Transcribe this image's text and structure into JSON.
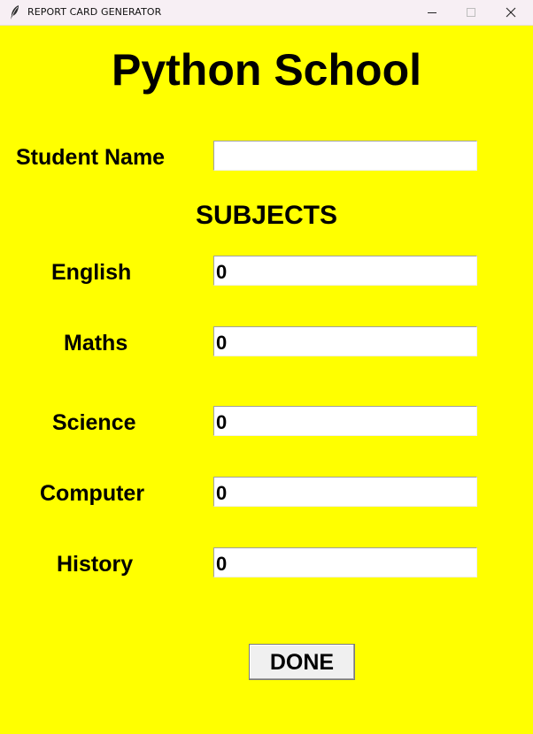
{
  "window": {
    "title": "REPORT CARD GENERATOR",
    "icon": "feather-icon",
    "controls": [
      "minimize-icon",
      "maximize-icon",
      "close-icon"
    ]
  },
  "heading": "Python School",
  "student": {
    "label": "Student Name",
    "value": ""
  },
  "subjects_heading": "SUBJECTS",
  "subjects": [
    {
      "label": "English",
      "value": "0"
    },
    {
      "label": "Maths",
      "value": "0"
    },
    {
      "label": "Science",
      "value": "0"
    },
    {
      "label": "Computer",
      "value": "0"
    },
    {
      "label": "History",
      "value": "0"
    }
  ],
  "done_label": "DONE",
  "colors": {
    "background": "#ffff00",
    "titlebar": "#f7eff4",
    "button": "#f0f0f0"
  }
}
